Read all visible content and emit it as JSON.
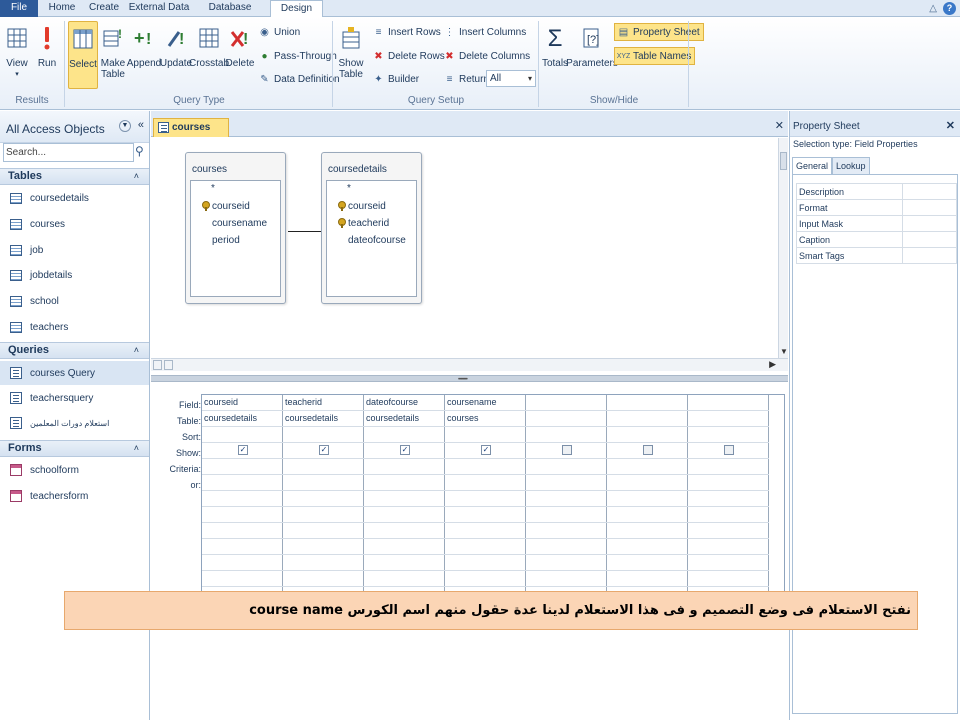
{
  "tabs": [
    "File",
    "Home",
    "Create",
    "External Data",
    "Database Tools",
    "Design"
  ],
  "groups": {
    "results": "Results",
    "query_type": "Query Type",
    "query_setup": "Query Setup",
    "show_hide": "Show/Hide"
  },
  "buttons": {
    "view": "View",
    "run": "Run",
    "select": "Select",
    "make_table": "Make\nTable",
    "append": "Append",
    "update": "Update",
    "crosstab": "Crosstab",
    "delete": "Delete",
    "union": "Union",
    "pass_through": "Pass-Through",
    "data_definition": "Data Definition",
    "show_table": "Show\nTable",
    "insert_rows": "Insert Rows",
    "delete_rows": "Delete Rows",
    "builder": "Builder",
    "insert_columns": "Insert Columns",
    "delete_columns": "Delete Columns",
    "return_label": "Return:",
    "return_value": "All",
    "totals": "Totals",
    "parameters": "Parameters",
    "property_sheet": "Property Sheet",
    "table_names": "Table Names"
  },
  "nav": {
    "title": "All Access Objects",
    "search_placeholder": "Search...",
    "sections": {
      "tables": "Tables",
      "queries": "Queries",
      "forms": "Forms"
    },
    "tables": [
      "coursedetails",
      "courses",
      "job",
      "jobdetails",
      "school",
      "teachers"
    ],
    "queries": [
      "courses Query",
      "teachersquery",
      "استعلام دورات المعلمين"
    ],
    "forms": [
      "schoolform",
      "teachersform"
    ]
  },
  "doc": {
    "tab_label": "courses Query"
  },
  "field_lists": [
    {
      "title": "courses",
      "fields": [
        "*",
        "courseid",
        "coursename",
        "period"
      ],
      "keys": [
        false,
        true,
        false,
        false
      ]
    },
    {
      "title": "coursedetails",
      "fields": [
        "*",
        "courseid",
        "teacherid",
        "dateofcourse"
      ],
      "keys": [
        false,
        true,
        true,
        false
      ]
    }
  ],
  "grid": {
    "row_labels": [
      "Field:",
      "Table:",
      "Sort:",
      "Show:",
      "Criteria:",
      "or:"
    ],
    "columns": [
      {
        "field": "courseid",
        "table": "coursedetails",
        "show": true
      },
      {
        "field": "teacherid",
        "table": "coursedetails",
        "show": true
      },
      {
        "field": "dateofcourse",
        "table": "coursedetails",
        "show": true
      },
      {
        "field": "coursename",
        "table": "courses",
        "show": true
      },
      {
        "field": "",
        "table": "",
        "show": false
      },
      {
        "field": "",
        "table": "",
        "show": false
      },
      {
        "field": "",
        "table": "",
        "show": false
      }
    ]
  },
  "property_sheet": {
    "title": "Property Sheet",
    "selection_type": "Selection type:  Field Properties",
    "tabs": [
      "General",
      "Lookup"
    ],
    "rows": [
      "Description",
      "Format",
      "Input Mask",
      "Caption",
      "Smart Tags"
    ]
  },
  "caption": "نفتح الاستعلام فى وضع التصميم  و فى هذا الاستعلام لدينا عدة حقول منهم اسم الكورس course name",
  "colors": {
    "file_tab": "#2d5a9a",
    "highlight": "#fde48a",
    "caption_bg": "#fbd5b5"
  }
}
